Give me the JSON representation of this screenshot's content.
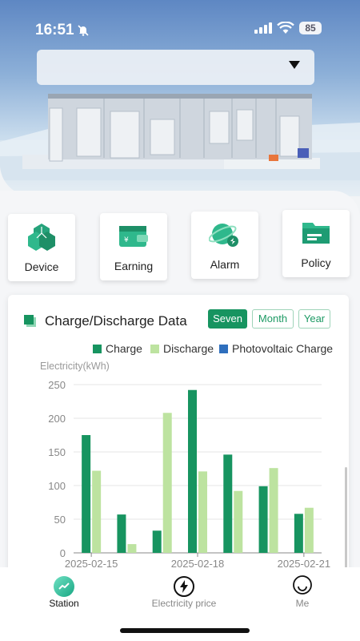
{
  "status_bar": {
    "time": "16:51",
    "battery": "85"
  },
  "station_selector": {
    "value": ""
  },
  "menu": [
    {
      "label": "Device",
      "icon": "cubes-icon"
    },
    {
      "label": "Earning",
      "icon": "wallet-icon"
    },
    {
      "label": "Alarm",
      "icon": "alarm-icon"
    },
    {
      "label": "Policy",
      "icon": "folder-icon"
    }
  ],
  "chart_section": {
    "title": "Charge/Discharge Data",
    "ranges": [
      "Seven",
      "Month",
      "Year"
    ],
    "active_range": "Seven"
  },
  "chart_data": {
    "type": "bar",
    "ylabel": "Electricity(kWh)",
    "ylim": [
      0,
      250
    ],
    "yticks": [
      0,
      50,
      100,
      150,
      200,
      250
    ],
    "x_tick_labels": [
      "2025-02-15",
      "2025-02-18",
      "2025-02-21"
    ],
    "series": [
      {
        "name": "Charge",
        "color": "#179460",
        "values": [
          175,
          57,
          33,
          242,
          146,
          99,
          58
        ]
      },
      {
        "name": "Discharge",
        "color": "#bde3a0",
        "values": [
          122,
          13,
          208,
          121,
          92,
          126,
          67
        ]
      },
      {
        "name": "Photovoltaic Charge",
        "color": "#2f6fbd",
        "values": [
          0,
          0,
          0,
          0,
          0,
          0,
          0
        ]
      }
    ],
    "grid": true,
    "legend": "top"
  },
  "bottom_nav": [
    {
      "label": "Station",
      "icon": "station-icon",
      "active": true
    },
    {
      "label": "Electricity price",
      "icon": "lightning-icon",
      "active": false
    },
    {
      "label": "Me",
      "icon": "smiley-icon",
      "active": false
    }
  ],
  "colors": {
    "accent": "#179460",
    "accent_light": "#23b08a"
  }
}
